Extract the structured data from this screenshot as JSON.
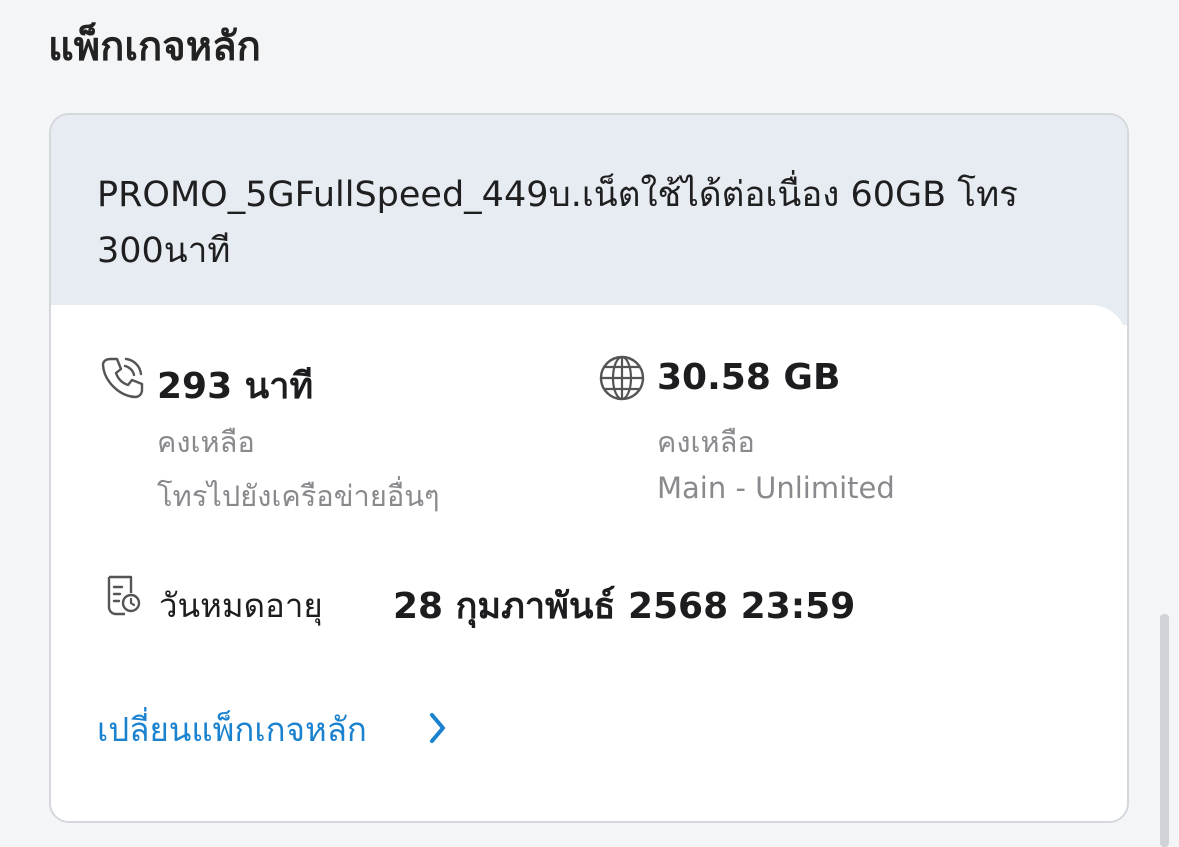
{
  "section": {
    "title": "แพ็กเกจหลัก"
  },
  "package": {
    "name": "PROMO_5GFullSpeed_449บ.เน็ตใช้ได้ต่อเนื่อง 60GB โทร 300นาที"
  },
  "voice": {
    "icon": "phone-icon",
    "value": "293 นาที",
    "remaining_label": "คงเหลือ",
    "description": "โทรไปยังเครือข่ายอื่นๆ"
  },
  "data": {
    "icon": "globe-icon",
    "value": "30.58 GB",
    "remaining_label": "คงเหลือ",
    "description": "Main - Unlimited"
  },
  "expiry": {
    "icon": "document-clock-icon",
    "label": "วันหมดอายุ",
    "value": "28 กุมภาพันธ์ 2568 23:59"
  },
  "actions": {
    "change_package_label": "เปลี่ยนแพ็กเกจหลัก",
    "chevron_icon": "chevron-right-icon"
  },
  "colors": {
    "link": "#1a82cf",
    "header_bg": "#e6ecf2",
    "muted_text": "#8a8a8e"
  }
}
